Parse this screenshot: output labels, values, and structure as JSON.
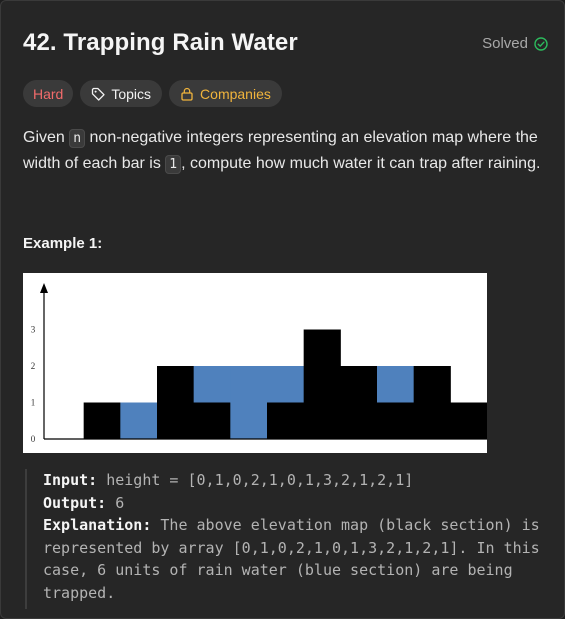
{
  "problem": {
    "title": "42. Trapping Rain Water",
    "status": "Solved"
  },
  "tags": {
    "difficulty": "Hard",
    "topics": "Topics",
    "companies": "Companies"
  },
  "colors": {
    "hard": "#f26b6b",
    "companies": "#f0b43c",
    "solved_check": "#2cbb5d",
    "water": "#4f81bd",
    "bar": "#000000"
  },
  "description": {
    "part1": "Given ",
    "code1": "n",
    "part2": " non-negative integers representing an elevation map where the width of each bar is ",
    "code2": "1",
    "part3": ", compute how much water it can trap after raining."
  },
  "example": {
    "title": "Example 1:",
    "input_label": "Input:",
    "input_value": "height = [0,1,0,2,1,0,1,3,2,1,2,1]",
    "output_label": "Output:",
    "output_value": "6",
    "explanation_label": "Explanation:",
    "explanation_text": "The above elevation map (black section) is represented by array [0,1,0,2,1,0,1,3,2,1,2,1]. In this case, 6 units of rain water (blue section) are being trapped."
  },
  "chart_data": {
    "type": "bar",
    "heights": [
      0,
      1,
      0,
      2,
      1,
      0,
      1,
      3,
      2,
      1,
      2,
      1
    ],
    "water": [
      0,
      0,
      1,
      0,
      1,
      2,
      1,
      0,
      0,
      1,
      0,
      0
    ],
    "ytick_labels": [
      "0",
      "1",
      "2",
      "3"
    ],
    "ylim": [
      0,
      4
    ]
  }
}
